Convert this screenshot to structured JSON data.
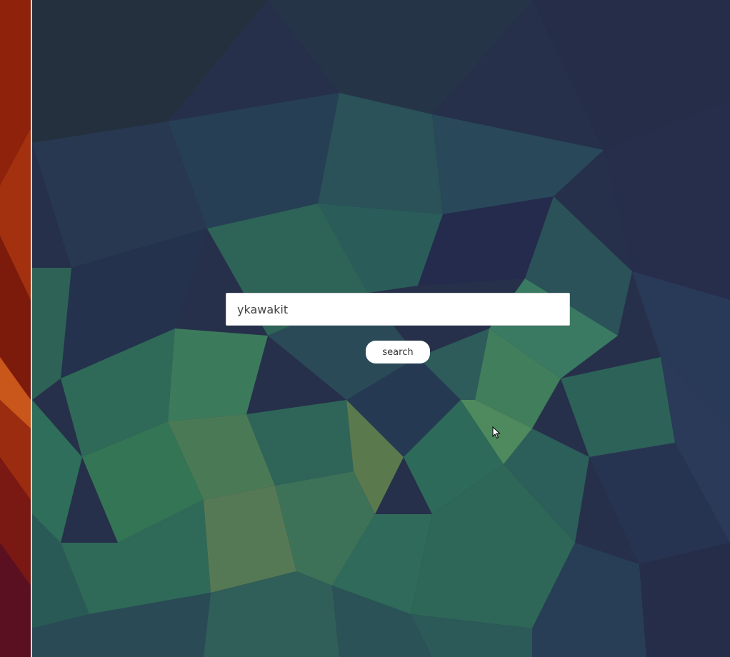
{
  "search": {
    "value": "ykawakit",
    "button_label": "search"
  },
  "icons": {
    "cursor": "mouse-pointer-icon"
  },
  "colors": {
    "background_dark": "#26304a",
    "background_green": "#2e6a5a",
    "desktop_orange": "#a8360f",
    "input_background": "#ffffff",
    "button_background": "#ffffff"
  }
}
